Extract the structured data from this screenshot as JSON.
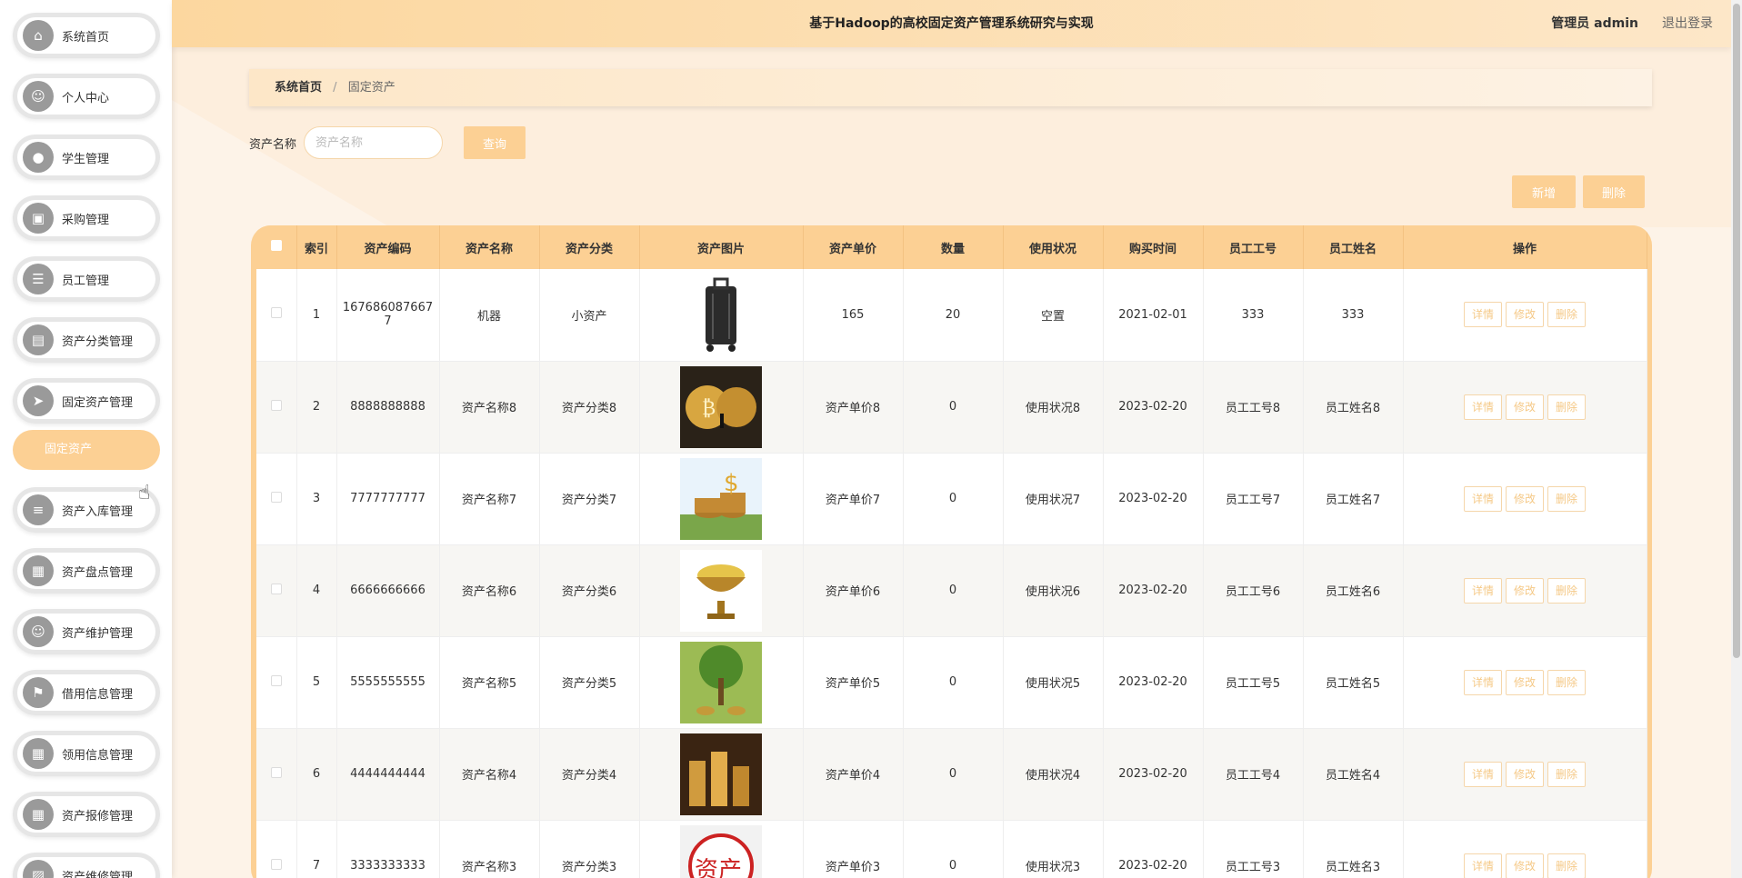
{
  "header": {
    "title": "基于Hadoop的高校固定资产管理系统研究与实现",
    "user": "管理员 admin",
    "logout": "退出登录"
  },
  "sidebar": {
    "items": [
      {
        "label": "系统首页",
        "icon": "home-icon",
        "glyph": "⌂"
      },
      {
        "label": "个人中心",
        "icon": "user-icon",
        "glyph": "☺"
      },
      {
        "label": "学生管理",
        "icon": "location-icon",
        "glyph": "●"
      },
      {
        "label": "采购管理",
        "icon": "briefcase-icon",
        "glyph": "▣"
      },
      {
        "label": "员工管理",
        "icon": "list-icon",
        "glyph": "☰"
      },
      {
        "label": "资产分类管理",
        "icon": "printer-icon",
        "glyph": "▤"
      },
      {
        "label": "固定资产管理",
        "icon": "send-icon",
        "glyph": "➤"
      },
      {
        "label": "资产入库管理",
        "icon": "sliders-icon",
        "glyph": "≡"
      },
      {
        "label": "资产盘点管理",
        "icon": "grid-icon",
        "glyph": "▦"
      },
      {
        "label": "资产维护管理",
        "icon": "user-icon",
        "glyph": "☺"
      },
      {
        "label": "借用信息管理",
        "icon": "flag-icon",
        "glyph": "⚑"
      },
      {
        "label": "领用信息管理",
        "icon": "apps-icon",
        "glyph": "▦"
      },
      {
        "label": "资产报修管理",
        "icon": "grid-icon",
        "glyph": "▦"
      },
      {
        "label": "资产维修管理",
        "icon": "chart-icon",
        "glyph": "▨"
      }
    ],
    "active_sub": "固定资产"
  },
  "breadcrumb": {
    "home": "系统首页",
    "separator": "/",
    "current": "固定资产"
  },
  "search": {
    "label": "资产名称",
    "placeholder": "资产名称",
    "value": "",
    "button": "查询"
  },
  "actions": {
    "add": "新增",
    "delete": "删除"
  },
  "table": {
    "headers": [
      "索引",
      "资产编码",
      "资产名称",
      "资产分类",
      "资产图片",
      "资产单价",
      "数量",
      "使用状况",
      "购买时间",
      "员工工号",
      "员工姓名",
      "操作"
    ],
    "op_labels": {
      "detail": "详情",
      "edit": "修改",
      "delete": "删除"
    },
    "rows": [
      {
        "index": "1",
        "code": "1676860876677",
        "name": "机器",
        "category": "小资产",
        "image": "suitcase",
        "price": "165",
        "qty": "20",
        "status": "空置",
        "date": "2021-02-01",
        "emp_no": "333",
        "emp_name": "333"
      },
      {
        "index": "2",
        "code": "8888888888",
        "name": "资产名称8",
        "category": "资产分类8",
        "image": "bitcoin",
        "price": "资产单价8",
        "qty": "0",
        "status": "使用状况8",
        "date": "2023-02-20",
        "emp_no": "员工工号8",
        "emp_name": "员工姓名8"
      },
      {
        "index": "3",
        "code": "7777777777",
        "name": "资产名称7",
        "category": "资产分类7",
        "image": "dollar-coins",
        "price": "资产单价7",
        "qty": "0",
        "status": "使用状况7",
        "date": "2023-02-20",
        "emp_no": "员工工号7",
        "emp_name": "员工姓名7"
      },
      {
        "index": "4",
        "code": "6666666666",
        "name": "资产名称6",
        "category": "资产分类6",
        "image": "gold-bowl",
        "price": "资产单价6",
        "qty": "0",
        "status": "使用状况6",
        "date": "2023-02-20",
        "emp_no": "员工工号6",
        "emp_name": "员工姓名6"
      },
      {
        "index": "5",
        "code": "5555555555",
        "name": "资产名称5",
        "category": "资产分类5",
        "image": "money-tree",
        "price": "资产单价5",
        "qty": "0",
        "status": "使用状况5",
        "date": "2023-02-20",
        "emp_no": "员工工号5",
        "emp_name": "员工姓名5"
      },
      {
        "index": "6",
        "code": "4444444444",
        "name": "资产名称4",
        "category": "资产分类4",
        "image": "coin-stacks",
        "price": "资产单价4",
        "qty": "0",
        "status": "使用状况4",
        "date": "2023-02-20",
        "emp_no": "员工工号4",
        "emp_name": "员工姓名4"
      },
      {
        "index": "7",
        "code": "3333333333",
        "name": "资产名称3",
        "category": "资产分类3",
        "image": "asset-sign",
        "price": "资产单价3",
        "qty": "0",
        "status": "使用状况3",
        "date": "2023-02-20",
        "emp_no": "员工工号3",
        "emp_name": "员工姓名3"
      }
    ]
  },
  "colors": {
    "accent": "#fcd094",
    "header_start": "#fcd79f",
    "page_bg": "#fdeedd"
  }
}
